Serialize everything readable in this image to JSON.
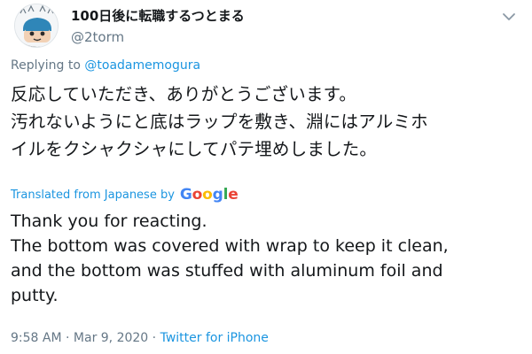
{
  "author": {
    "display_name": "100日後に転職するつとまる",
    "handle": "@2torm",
    "avatar_icon": "cartoon-avatar-icon"
  },
  "reply": {
    "prefix": "Replying to ",
    "mention": "@toadamemogura"
  },
  "tweet": {
    "lines": [
      "反応していただき、ありがとうございます。",
      "汚れないようにと底はラップを敷き、淵にはアルミホ",
      "イルをクシャクシャにしてパテ埋めしました。"
    ]
  },
  "translation": {
    "label": "Translated from Japanese by",
    "provider_letters": [
      "G",
      "o",
      "o",
      "g",
      "l",
      "e"
    ],
    "text": "Thank you for reacting.\n The bottom was covered with wrap to keep it clean,\nand the bottom was stuffed with aluminum foil and\nputty."
  },
  "meta": {
    "time": "9:58 AM",
    "separator1": " · ",
    "date": "Mar 9, 2020",
    "separator2": " · ",
    "source": "Twitter for iPhone"
  },
  "colors": {
    "link": "#1b95e0",
    "secondary_text": "#657786",
    "primary_text": "#14171a"
  }
}
